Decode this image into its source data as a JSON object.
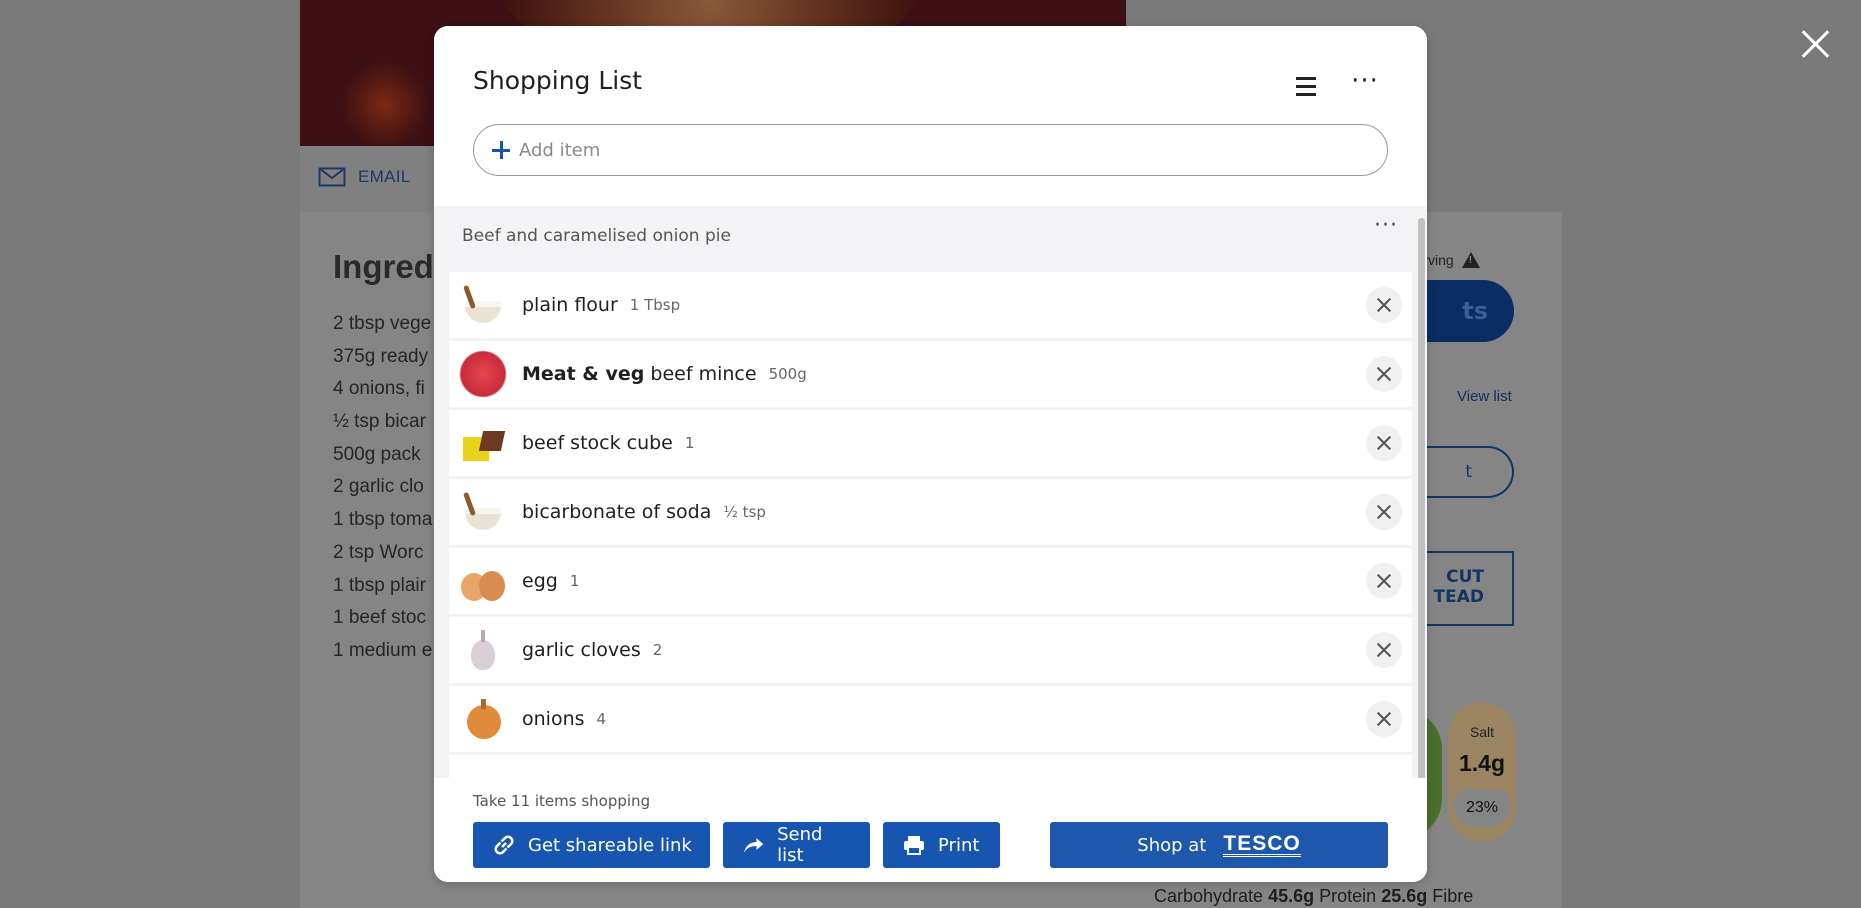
{
  "background": {
    "email_label": "EMAIL",
    "ingredients_title": "Ingredi",
    "ingredients": [
      "2 tbsp vege",
      "375g ready",
      "4 onions, fi",
      "½ tsp bicar",
      "500g pack",
      "2 garlic clo",
      "1 tbsp toma",
      "2 tsp Worc",
      "1 tbsp plair",
      "1 beef stoc",
      "1 medium e"
    ],
    "per_serving": "r serving",
    "solid_button_fragment": "ts",
    "view_list": "View list",
    "outline_button_fragment": "t",
    "cut_box_line1": "CUT",
    "cut_box_line2": "TEAD",
    "salt_label": "Salt",
    "salt_value": "1.4g",
    "salt_percent": "23%",
    "nutrition": {
      "carb_label": "Carbohydrate",
      "carb_value": "45.6g",
      "protein_label": "Protein",
      "protein_value": "25.6g",
      "fibre_label": "Fibre"
    }
  },
  "modal": {
    "title": "Shopping List",
    "add_item_placeholder": "Add item",
    "group_title": "Beef and caramelised onion pie",
    "items": [
      {
        "brand": "",
        "name": "plain flour",
        "qty": "1 Tbsp",
        "icon": "flour-icon"
      },
      {
        "brand": "Meat & veg",
        "name": "beef mince",
        "qty": "500g",
        "icon": "mince-icon"
      },
      {
        "brand": "",
        "name": "beef stock cube",
        "qty": "1",
        "icon": "stock-cube-icon"
      },
      {
        "brand": "",
        "name": "bicarbonate of soda",
        "qty": "½ tsp",
        "icon": "flour-icon"
      },
      {
        "brand": "",
        "name": "egg",
        "qty": "1",
        "icon": "egg-icon"
      },
      {
        "brand": "",
        "name": "garlic cloves",
        "qty": "2",
        "icon": "garlic-icon"
      },
      {
        "brand": "",
        "name": "onions",
        "qty": "4",
        "icon": "onion-icon"
      }
    ],
    "footer": {
      "take_text": "Take 11 items shopping",
      "share_label": "Get shareable link",
      "send_label": "Send list",
      "print_label": "Print",
      "shop_label": "Shop at",
      "shop_brand": "TESCO"
    }
  },
  "colors": {
    "accent": "#1756b0",
    "overlay": "#7a7a7a",
    "list_bg": "#f3f3f5"
  }
}
